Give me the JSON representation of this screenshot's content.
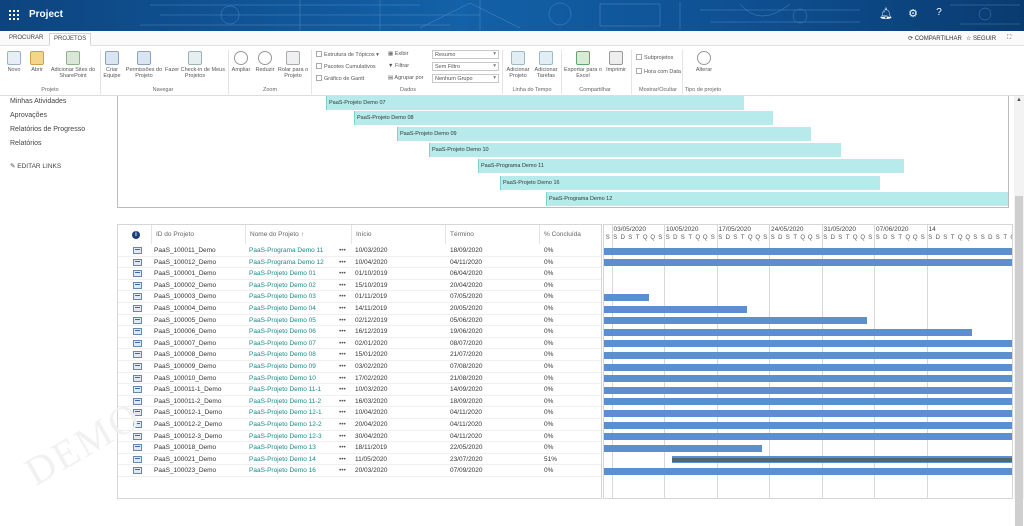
{
  "app": {
    "title": "Project"
  },
  "header_icons": [
    "bell-icon",
    "gear-icon",
    "help-icon"
  ],
  "tabs": [
    {
      "label": "PROCURAR"
    },
    {
      "label": "PROJETOS"
    }
  ],
  "top_right": {
    "share": "COMPARTILHAR",
    "follow": "SEGUIR"
  },
  "ribbon": {
    "projeto": {
      "new": "Novo",
      "open": "Abrir",
      "add_sites": "Adicionar Sites do SharePoint",
      "group": "Projeto"
    },
    "navegar": {
      "build_team": "Criar Equipe",
      "permissions": "Permissões do Projeto",
      "checkin": "Fazer Check-in de Meus Projetos",
      "group": "Navegar"
    },
    "zoom": {
      "in": "Ampliar",
      "out": "Reduzir",
      "scroll": "Rolar para o Projeto",
      "group": "Zoom"
    },
    "dados": {
      "outline": "Estrutura de Tópicos",
      "rollup": "Pacotes Cumulativos",
      "gantt": "Gráfico de Gantt",
      "view": "Exibir",
      "filter": "Filtrar",
      "group_by": "Agrupar por",
      "view_value": "Resumo",
      "filter_value": "Sem Filtro",
      "group_value": "Nenhum Grupo",
      "group": "Dados"
    },
    "timeline": {
      "add_project": "Adicionar Projeto",
      "add_tasks": "Adicionar Tarefas",
      "group": "Linha do Tempo"
    },
    "share": {
      "export": "Exportar para o Excel",
      "print": "Imprimir",
      "group": "Compartilhar"
    },
    "show": {
      "subprojects": "Subprojetos",
      "time_date": "Hora com Data",
      "group": "Mostrar/Ocultar"
    },
    "type": {
      "change": "Alterar",
      "group": "Tipo de projeto"
    }
  },
  "leftnav": {
    "items": [
      "Minhas Atividades",
      "Aprovações",
      "Relatórios de Progresso",
      "Relatórios"
    ],
    "edit": "EDITAR LINKS"
  },
  "timeline": [
    {
      "label": "PaaS-Projeto Demo 07"
    },
    {
      "label": "PaaS-Projeto Demo 08"
    },
    {
      "label": "PaaS-Projeto Demo 09"
    },
    {
      "label": "PaaS-Projeto Demo 10"
    },
    {
      "label": "PaaS-Programa Demo 11"
    },
    {
      "label": "PaaS-Projeto Demo 16"
    },
    {
      "label": "PaaS-Programa Demo 12"
    }
  ],
  "grid": {
    "headers": {
      "id": "ID do Projeto",
      "name": "Nome do Projeto ↑",
      "start": "Início",
      "end": "Término",
      "pct": "% Concluída"
    },
    "rows": [
      {
        "id": "PaaS_100011_Demo",
        "name": "PaaS-Programa Demo 11",
        "start": "10/03/2020",
        "end": "18/09/2020",
        "pct": "0%"
      },
      {
        "id": "PaaS_100012_Demo",
        "name": "PaaS-Programa Demo 12",
        "start": "10/04/2020",
        "end": "04/11/2020",
        "pct": "0%"
      },
      {
        "id": "PaaS_100001_Demo",
        "name": "PaaS-Projeto Demo 01",
        "start": "01/10/2019",
        "end": "06/04/2020",
        "pct": "0%"
      },
      {
        "id": "PaaS_100002_Demo",
        "name": "PaaS-Projeto Demo 02",
        "start": "15/10/2019",
        "end": "20/04/2020",
        "pct": "0%"
      },
      {
        "id": "PaaS_100003_Demo",
        "name": "PaaS-Projeto Demo 03",
        "start": "01/11/2019",
        "end": "07/05/2020",
        "pct": "0%"
      },
      {
        "id": "PaaS_100004_Demo",
        "name": "PaaS-Projeto Demo 04",
        "start": "14/11/2019",
        "end": "20/05/2020",
        "pct": "0%"
      },
      {
        "id": "PaaS_100005_Demo",
        "name": "PaaS-Projeto Demo 05",
        "start": "02/12/2019",
        "end": "05/06/2020",
        "pct": "0%"
      },
      {
        "id": "PaaS_100006_Demo",
        "name": "PaaS-Projeto Demo 06",
        "start": "16/12/2019",
        "end": "19/06/2020",
        "pct": "0%"
      },
      {
        "id": "PaaS_100007_Demo",
        "name": "PaaS-Projeto Demo 07",
        "start": "02/01/2020",
        "end": "08/07/2020",
        "pct": "0%"
      },
      {
        "id": "PaaS_100008_Demo",
        "name": "PaaS-Projeto Demo 08",
        "start": "15/01/2020",
        "end": "21/07/2020",
        "pct": "0%"
      },
      {
        "id": "PaaS_100009_Demo",
        "name": "PaaS-Projeto Demo 09",
        "start": "03/02/2020",
        "end": "07/08/2020",
        "pct": "0%"
      },
      {
        "id": "PaaS_100010_Demo",
        "name": "PaaS-Projeto Demo 10",
        "start": "17/02/2020",
        "end": "21/08/2020",
        "pct": "0%"
      },
      {
        "id": "PaaS_100011-1_Demo",
        "name": "PaaS-Projeto Demo 11-1",
        "start": "10/03/2020",
        "end": "14/09/2020",
        "pct": "0%"
      },
      {
        "id": "PaaS_100011-2_Demo",
        "name": "PaaS-Projeto Demo 11-2",
        "start": "16/03/2020",
        "end": "18/09/2020",
        "pct": "0%"
      },
      {
        "id": "PaaS_100012-1_Demo",
        "name": "PaaS-Projeto Demo 12-1",
        "start": "10/04/2020",
        "end": "04/11/2020",
        "pct": "0%"
      },
      {
        "id": "PaaS_100012-2_Demo",
        "name": "PaaS-Projeto Demo 12-2",
        "start": "20/04/2020",
        "end": "04/11/2020",
        "pct": "0%"
      },
      {
        "id": "PaaS_100012-3_Demo",
        "name": "PaaS-Projeto Demo 12-3",
        "start": "30/04/2020",
        "end": "04/11/2020",
        "pct": "0%"
      },
      {
        "id": "PaaS_100018_Demo",
        "name": "PaaS-Projeto Demo 13",
        "start": "18/11/2019",
        "end": "22/05/2020",
        "pct": "0%"
      },
      {
        "id": "PaaS_100021_Demo",
        "name": "PaaS-Projeto Demo 14",
        "start": "11/05/2020",
        "end": "23/07/2020",
        "pct": "51%"
      },
      {
        "id": "PaaS_100023_Demo",
        "name": "PaaS-Projeto Demo 16",
        "start": "20/03/2020",
        "end": "07/09/2020",
        "pct": "0%"
      }
    ]
  },
  "gantt": {
    "weeks": [
      "03/05/2020",
      "10/05/2020",
      "17/05/2020",
      "24/05/2020",
      "31/05/2020",
      "07/06/2020",
      "14"
    ],
    "days": [
      "S",
      "D",
      "S",
      "T",
      "Q",
      "Q",
      "S"
    ],
    "first_visible_day": "02/05/2020"
  },
  "watermark": "DEMO"
}
